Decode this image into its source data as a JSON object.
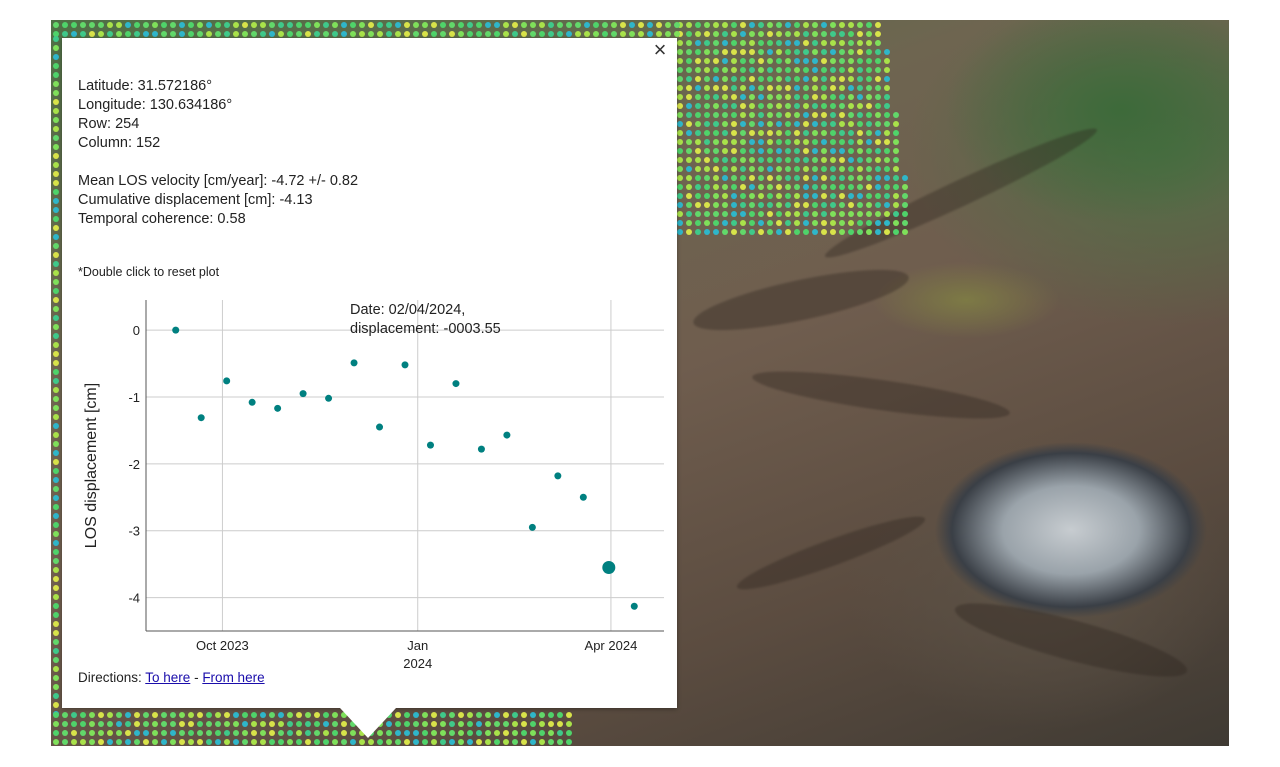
{
  "colors": {
    "point": "#008080",
    "grid": "#cccccc",
    "link": "#1a0dab"
  },
  "popup": {
    "close_icon": "×",
    "info": {
      "latitude": "Latitude: 31.572186°",
      "longitude": "Longitude: 130.634186°",
      "row": "Row: 254",
      "column": "Column: 152",
      "velocity": "Mean LOS velocity [cm/year]: -4.72 +/- 0.82",
      "cumulative": "Cumulative displacement [cm]: -4.13",
      "coherence": "Temporal coherence: 0.58"
    },
    "reset_note": "*Double click to reset plot",
    "directions": {
      "label": "Directions: ",
      "to_here": "To here",
      "separator": " - ",
      "from_here": "From here"
    }
  },
  "chart_data": {
    "type": "scatter",
    "ylabel": "LOS displacement [cm]",
    "xlabel": "",
    "ylim": [
      -4.5,
      0.45
    ],
    "yticks": [
      0,
      -1,
      -2,
      -3,
      -4
    ],
    "ytick_labels": [
      "0",
      "-1",
      "-2",
      "-3",
      "-4"
    ],
    "xlim": [
      "2023-08-26",
      "2024-04-26"
    ],
    "xticks": [
      {
        "date": "2023-10-01",
        "label": "Oct 2023",
        "sublabel": ""
      },
      {
        "date": "2024-01-01",
        "label": "Jan",
        "sublabel": "2024"
      },
      {
        "date": "2024-04-01",
        "label": "Apr 2024",
        "sublabel": ""
      }
    ],
    "grid": true,
    "points": [
      {
        "x": "2023-09-09",
        "y": 0.0
      },
      {
        "x": "2023-09-21",
        "y": -1.31
      },
      {
        "x": "2023-10-03",
        "y": -0.76
      },
      {
        "x": "2023-10-15",
        "y": -1.08
      },
      {
        "x": "2023-10-27",
        "y": -1.17
      },
      {
        "x": "2023-11-08",
        "y": -0.95
      },
      {
        "x": "2023-11-20",
        "y": -1.02
      },
      {
        "x": "2023-12-02",
        "y": -0.49
      },
      {
        "x": "2023-12-14",
        "y": -1.45
      },
      {
        "x": "2023-12-26",
        "y": -0.52
      },
      {
        "x": "2024-01-07",
        "y": -1.72
      },
      {
        "x": "2024-01-19",
        "y": -0.8
      },
      {
        "x": "2024-01-31",
        "y": -1.78
      },
      {
        "x": "2024-02-12",
        "y": -1.57
      },
      {
        "x": "2024-02-24",
        "y": -2.95
      },
      {
        "x": "2024-03-07",
        "y": -2.18
      },
      {
        "x": "2024-03-19",
        "y": -2.5
      },
      {
        "x": "2024-03-31",
        "y": -3.55
      },
      {
        "x": "2024-04-12",
        "y": -4.13
      }
    ],
    "highlighted_index": 17,
    "tooltip": {
      "date_line": "Date: 02/04/2024,",
      "value_line": "displacement: -0003.55"
    }
  }
}
